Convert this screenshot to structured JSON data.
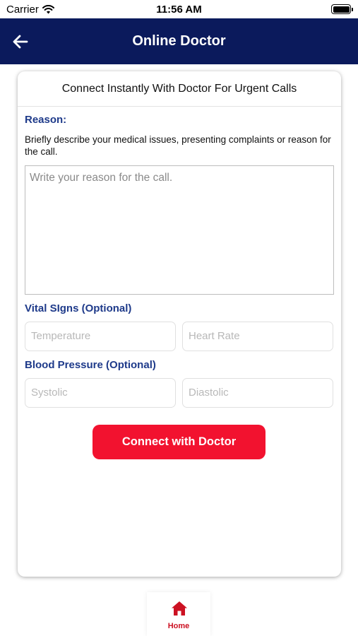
{
  "status_bar": {
    "carrier": "Carrier",
    "time": "11:56 AM"
  },
  "nav": {
    "title": "Online Doctor",
    "back_icon": "arrow-left-icon",
    "color": "#0b1a5c"
  },
  "card": {
    "header": "Connect Instantly With Doctor For Urgent Calls",
    "reason": {
      "label": "Reason:",
      "helper": "Briefly describe your medical issues, presenting complaints or reason for the call.",
      "placeholder": "Write your reason for the call.",
      "value": ""
    },
    "vitals": {
      "label": "Vital SIgns (Optional)",
      "temperature_placeholder": "Temperature",
      "heart_rate_placeholder": "Heart Rate"
    },
    "blood_pressure": {
      "label": "Blood Pressure (Optional)",
      "systolic_placeholder": "Systolic",
      "diastolic_placeholder": "Diastolic"
    },
    "connect_button": "Connect with Doctor"
  },
  "tab_bar": {
    "home_label": "Home",
    "home_icon": "home-icon"
  },
  "colors": {
    "accent": "#f2122f",
    "label": "#1e3a8a",
    "home_active": "#cc1122"
  }
}
